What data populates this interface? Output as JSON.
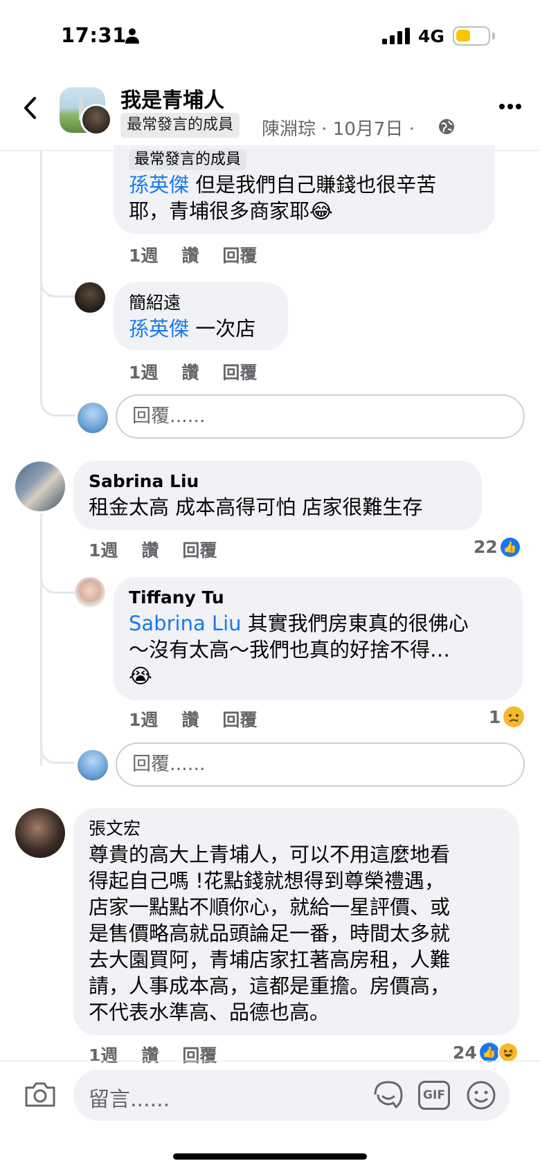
{
  "status_bar": {
    "time": "17:31",
    "network": "4G",
    "battery_level": 0.45
  },
  "header": {
    "group_name": "我是青埔人",
    "tag": "最常發言的成員",
    "meta": "陳淵琮 · 10月7日 ·"
  },
  "comments": [
    {
      "tag": "最常發言的成員",
      "mention": "孫英傑",
      "text_line1": " 但是我們自己賺錢也很辛苦",
      "text_line2": "耶，青埔很多商家耶😂",
      "time": "1週",
      "like": "讚",
      "reply": "回覆"
    },
    {
      "author": "簡紹遠",
      "mention": "孫英傑",
      "text": " 一次店",
      "time": "1週",
      "like": "讚",
      "reply": "回覆"
    },
    {
      "author": "Sabrina Liu",
      "text": "租金太高 成本高得可怕 店家很難生存",
      "time": "1週",
      "like": "讚",
      "reply": "回覆",
      "reaction_count": "22"
    },
    {
      "author": "Tiffany Tu",
      "mention": "Sabrina Liu",
      "text_line1": " 其實我們房東真的很佛心",
      "text_line2": "～沒有太高～我們也真的好捨不得…",
      "text_line3": "😭",
      "time": "1週",
      "like": "讚",
      "reply": "回覆",
      "reaction_count": "1"
    },
    {
      "author": "張文宏",
      "lines": [
        "尊貴的高大上青埔人，可以不用這麼地看",
        "得起自己嗎 !花點錢就想得到尊榮禮遇，",
        "店家一點點不順你心，就給一星評價、或",
        "是售價略高就品頭論足一番，時間太多就",
        "去大園買阿，青埔店家扛著高房租，人難",
        "請，人事成本高，這都是重擔。房價高，",
        "不代表水準高、品德也高。"
      ],
      "time": "1週",
      "like": "讚",
      "reply": "回覆",
      "reaction_count": "24"
    }
  ],
  "reply_placeholder": "回覆......",
  "composer_placeholder": "留言......",
  "gif_label": "GIF",
  "colors": {
    "link": "#1877f2",
    "bubble": "#f0f2f5",
    "muted": "#65676b"
  }
}
